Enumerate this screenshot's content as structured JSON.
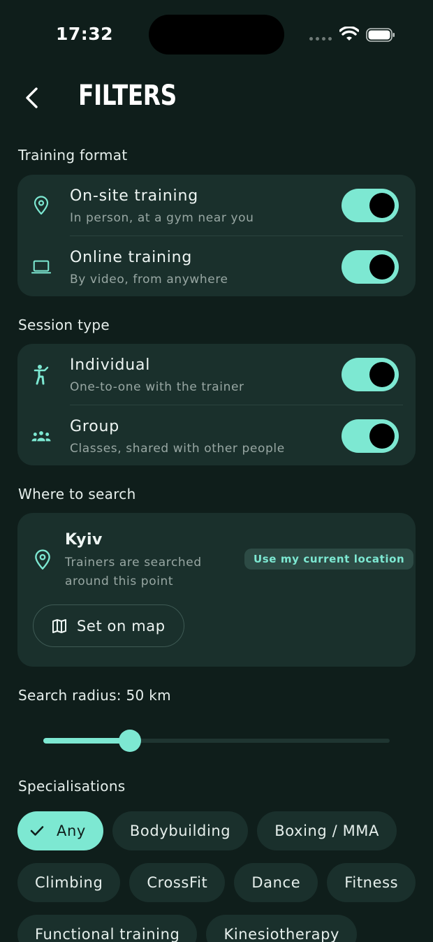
{
  "status_bar": {
    "time": "17:32"
  },
  "header": {
    "title": "FILTERS"
  },
  "training_format": {
    "label": "Training format",
    "items": [
      {
        "title": "On-site training",
        "subtitle": "In person, at a gym near you",
        "icon": "location-pin-icon",
        "enabled": true
      },
      {
        "title": "Online training",
        "subtitle": "By video, from anywhere",
        "icon": "laptop-icon",
        "enabled": true
      }
    ]
  },
  "session_type": {
    "label": "Session type",
    "items": [
      {
        "title": "Individual",
        "subtitle": "One-to-one with the trainer",
        "icon": "person-icon",
        "enabled": true
      },
      {
        "title": "Group",
        "subtitle": "Classes, shared with other people",
        "icon": "group-icon",
        "enabled": true
      }
    ]
  },
  "location": {
    "label": "Where to search",
    "city": "Kyiv",
    "subtitle": "Trainers are searched around this point",
    "use_current": "Use my current location",
    "set_on_map": "Set on map"
  },
  "radius": {
    "label": "Search radius: 50 km",
    "fraction": 0.25
  },
  "specialisations": {
    "label": "Specialisations",
    "chips": [
      {
        "label": "Any",
        "selected": true
      },
      {
        "label": "Bodybuilding",
        "selected": false
      },
      {
        "label": "Boxing / MMA",
        "selected": false
      },
      {
        "label": "Climbing",
        "selected": false
      },
      {
        "label": "CrossFit",
        "selected": false
      },
      {
        "label": "Dance",
        "selected": false
      },
      {
        "label": "Fitness",
        "selected": false
      },
      {
        "label": "Functional training",
        "selected": false
      },
      {
        "label": "Kinesiotherapy",
        "selected": false
      }
    ]
  },
  "colors": {
    "background": "#0f1e1b",
    "card": "#1a302c",
    "accent": "#7de8d2"
  }
}
